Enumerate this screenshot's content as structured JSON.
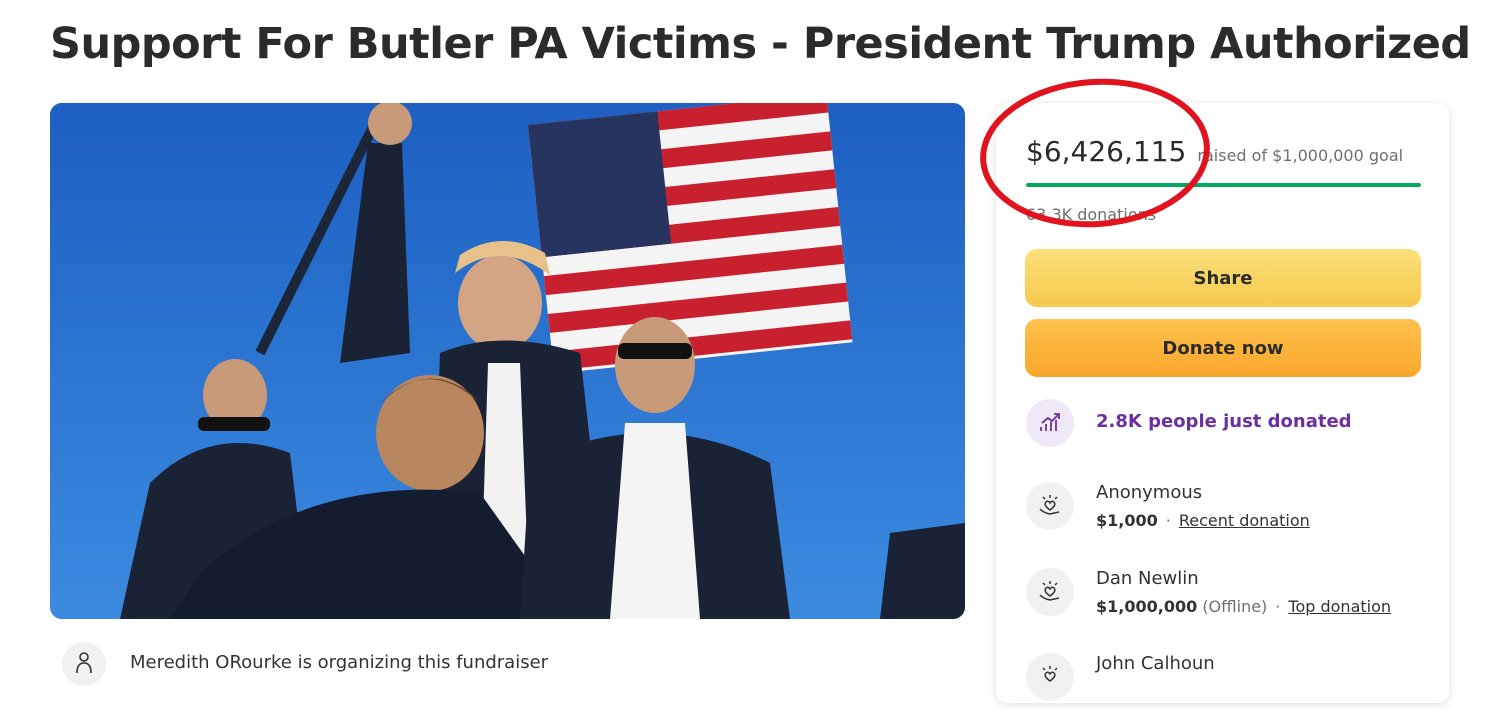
{
  "page": {
    "title": "Support For Butler PA Victims - President Trump Authorized"
  },
  "organizer": {
    "text": "Meredith ORourke is organizing this fundraiser"
  },
  "donation_card": {
    "raised_amount": "$6,426,115",
    "raised_of_goal": "raised of $1,000,000 goal",
    "progress_fraction": 1.0,
    "donations_count": "63.3K donations",
    "share_label": "Share",
    "donate_label": "Donate now",
    "just_donated": "2.8K people just donated",
    "donors": [
      {
        "name": "Anonymous",
        "amount": "$1,000",
        "status": "",
        "tag": "Recent donation"
      },
      {
        "name": "Dan Newlin",
        "amount": "$1,000,000",
        "status": "(Offline)",
        "tag": "Top donation"
      },
      {
        "name": "John Calhoun",
        "amount": "",
        "status": "",
        "tag": ""
      }
    ]
  },
  "colors": {
    "progress": "#02a95c",
    "share_button": "#f6c94c",
    "donate_button": "#f9a62b",
    "just_donated_text": "#6b2fa0",
    "annotation_circle": "#e0131f"
  },
  "icons": {
    "organizer": "person-icon",
    "trend": "trending-up-icon",
    "donor": "heart-hand-icon"
  }
}
